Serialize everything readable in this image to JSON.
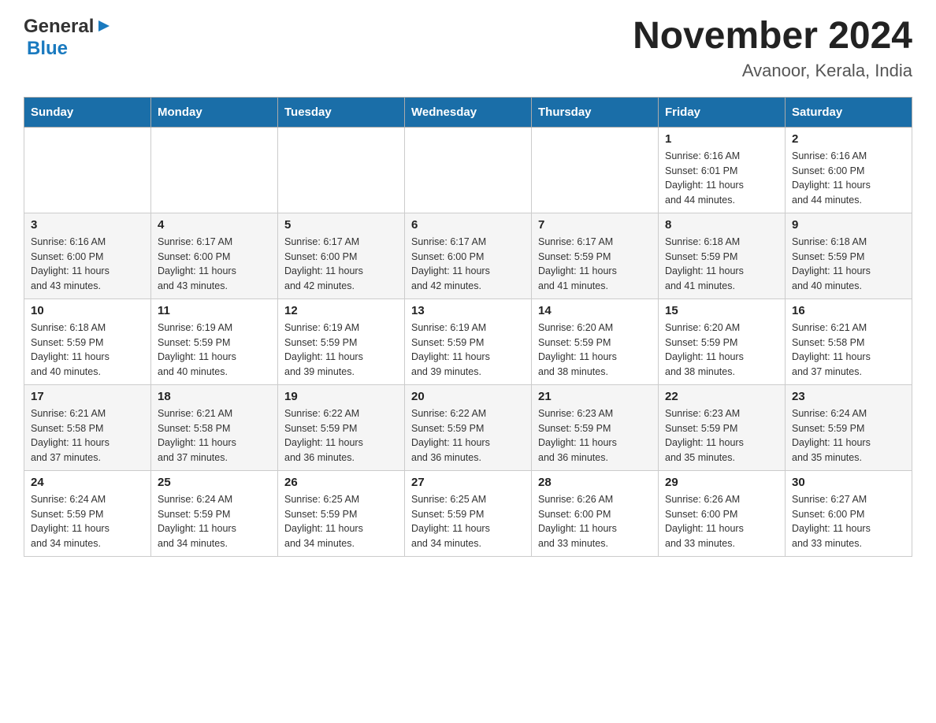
{
  "header": {
    "logo_general": "General",
    "logo_blue": "Blue",
    "month_title": "November 2024",
    "location": "Avanoor, Kerala, India"
  },
  "days_of_week": [
    "Sunday",
    "Monday",
    "Tuesday",
    "Wednesday",
    "Thursday",
    "Friday",
    "Saturday"
  ],
  "weeks": [
    [
      {
        "day": "",
        "info": ""
      },
      {
        "day": "",
        "info": ""
      },
      {
        "day": "",
        "info": ""
      },
      {
        "day": "",
        "info": ""
      },
      {
        "day": "",
        "info": ""
      },
      {
        "day": "1",
        "info": "Sunrise: 6:16 AM\nSunset: 6:01 PM\nDaylight: 11 hours\nand 44 minutes."
      },
      {
        "day": "2",
        "info": "Sunrise: 6:16 AM\nSunset: 6:00 PM\nDaylight: 11 hours\nand 44 minutes."
      }
    ],
    [
      {
        "day": "3",
        "info": "Sunrise: 6:16 AM\nSunset: 6:00 PM\nDaylight: 11 hours\nand 43 minutes."
      },
      {
        "day": "4",
        "info": "Sunrise: 6:17 AM\nSunset: 6:00 PM\nDaylight: 11 hours\nand 43 minutes."
      },
      {
        "day": "5",
        "info": "Sunrise: 6:17 AM\nSunset: 6:00 PM\nDaylight: 11 hours\nand 42 minutes."
      },
      {
        "day": "6",
        "info": "Sunrise: 6:17 AM\nSunset: 6:00 PM\nDaylight: 11 hours\nand 42 minutes."
      },
      {
        "day": "7",
        "info": "Sunrise: 6:17 AM\nSunset: 5:59 PM\nDaylight: 11 hours\nand 41 minutes."
      },
      {
        "day": "8",
        "info": "Sunrise: 6:18 AM\nSunset: 5:59 PM\nDaylight: 11 hours\nand 41 minutes."
      },
      {
        "day": "9",
        "info": "Sunrise: 6:18 AM\nSunset: 5:59 PM\nDaylight: 11 hours\nand 40 minutes."
      }
    ],
    [
      {
        "day": "10",
        "info": "Sunrise: 6:18 AM\nSunset: 5:59 PM\nDaylight: 11 hours\nand 40 minutes."
      },
      {
        "day": "11",
        "info": "Sunrise: 6:19 AM\nSunset: 5:59 PM\nDaylight: 11 hours\nand 40 minutes."
      },
      {
        "day": "12",
        "info": "Sunrise: 6:19 AM\nSunset: 5:59 PM\nDaylight: 11 hours\nand 39 minutes."
      },
      {
        "day": "13",
        "info": "Sunrise: 6:19 AM\nSunset: 5:59 PM\nDaylight: 11 hours\nand 39 minutes."
      },
      {
        "day": "14",
        "info": "Sunrise: 6:20 AM\nSunset: 5:59 PM\nDaylight: 11 hours\nand 38 minutes."
      },
      {
        "day": "15",
        "info": "Sunrise: 6:20 AM\nSunset: 5:59 PM\nDaylight: 11 hours\nand 38 minutes."
      },
      {
        "day": "16",
        "info": "Sunrise: 6:21 AM\nSunset: 5:58 PM\nDaylight: 11 hours\nand 37 minutes."
      }
    ],
    [
      {
        "day": "17",
        "info": "Sunrise: 6:21 AM\nSunset: 5:58 PM\nDaylight: 11 hours\nand 37 minutes."
      },
      {
        "day": "18",
        "info": "Sunrise: 6:21 AM\nSunset: 5:58 PM\nDaylight: 11 hours\nand 37 minutes."
      },
      {
        "day": "19",
        "info": "Sunrise: 6:22 AM\nSunset: 5:59 PM\nDaylight: 11 hours\nand 36 minutes."
      },
      {
        "day": "20",
        "info": "Sunrise: 6:22 AM\nSunset: 5:59 PM\nDaylight: 11 hours\nand 36 minutes."
      },
      {
        "day": "21",
        "info": "Sunrise: 6:23 AM\nSunset: 5:59 PM\nDaylight: 11 hours\nand 36 minutes."
      },
      {
        "day": "22",
        "info": "Sunrise: 6:23 AM\nSunset: 5:59 PM\nDaylight: 11 hours\nand 35 minutes."
      },
      {
        "day": "23",
        "info": "Sunrise: 6:24 AM\nSunset: 5:59 PM\nDaylight: 11 hours\nand 35 minutes."
      }
    ],
    [
      {
        "day": "24",
        "info": "Sunrise: 6:24 AM\nSunset: 5:59 PM\nDaylight: 11 hours\nand 34 minutes."
      },
      {
        "day": "25",
        "info": "Sunrise: 6:24 AM\nSunset: 5:59 PM\nDaylight: 11 hours\nand 34 minutes."
      },
      {
        "day": "26",
        "info": "Sunrise: 6:25 AM\nSunset: 5:59 PM\nDaylight: 11 hours\nand 34 minutes."
      },
      {
        "day": "27",
        "info": "Sunrise: 6:25 AM\nSunset: 5:59 PM\nDaylight: 11 hours\nand 34 minutes."
      },
      {
        "day": "28",
        "info": "Sunrise: 6:26 AM\nSunset: 6:00 PM\nDaylight: 11 hours\nand 33 minutes."
      },
      {
        "day": "29",
        "info": "Sunrise: 6:26 AM\nSunset: 6:00 PM\nDaylight: 11 hours\nand 33 minutes."
      },
      {
        "day": "30",
        "info": "Sunrise: 6:27 AM\nSunset: 6:00 PM\nDaylight: 11 hours\nand 33 minutes."
      }
    ]
  ]
}
